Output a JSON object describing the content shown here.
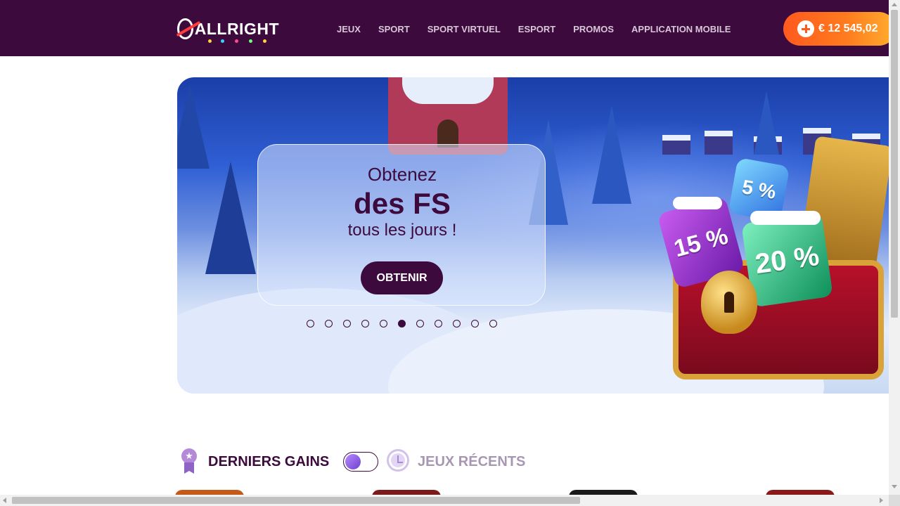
{
  "header": {
    "logo_text": "ALLRIGHT",
    "nav": [
      "JEUX",
      "SPORT",
      "SPORT VIRTUEL",
      "ESPORT",
      "PROMOS",
      "APPLICATION MOBILE"
    ],
    "balance": "€ 12 545,02",
    "colors": {
      "header_bg": "#3d0a3d",
      "balance_gradient_start": "#ff5a1e",
      "balance_gradient_end": "#ffae2e"
    }
  },
  "banner": {
    "line1": "Obtenez",
    "line2": "des FS",
    "line3": "tous les jours !",
    "cta": "OBTENIR",
    "gems": [
      "15 %",
      "5 %",
      "20 %"
    ],
    "slides_total": 11,
    "active_slide": 6
  },
  "section": {
    "title_left": "DERNIERS GAINS",
    "title_right": "JEUX RÉCENTS",
    "toggle_state": "off"
  },
  "icons": [
    "plus-icon",
    "award-ribbon-icon",
    "clock-history-icon"
  ]
}
